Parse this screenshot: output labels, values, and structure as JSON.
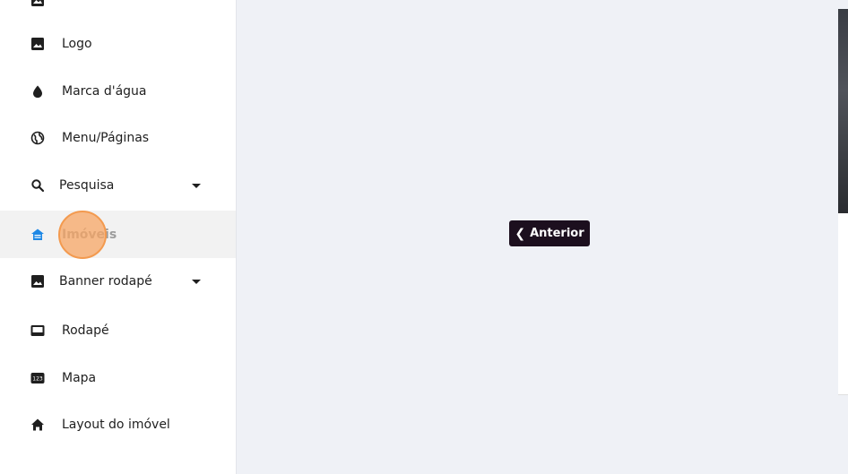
{
  "sidebar": {
    "items": [
      {
        "label": "",
        "icon": "image-icon"
      },
      {
        "label": "Logo",
        "icon": "image-icon"
      },
      {
        "label": "Marca d'água",
        "icon": "water-drop-icon"
      },
      {
        "label": "Menu/Páginas",
        "icon": "globe-icon"
      },
      {
        "label": "Pesquisa",
        "icon": "search-icon",
        "expandable": true
      },
      {
        "label": "Imóveis",
        "icon": "house-icon",
        "active": true
      },
      {
        "label": "Banner rodapé",
        "icon": "image-icon",
        "expandable": true
      },
      {
        "label": "Rodapé",
        "icon": "footer-icon"
      },
      {
        "label": "Mapa",
        "icon": "numbers-icon"
      },
      {
        "label": "Layout do imóvel",
        "icon": "home-icon"
      }
    ]
  },
  "main": {
    "previous_button_label": "Anterior"
  },
  "colors": {
    "active_icon": "#1e88e5",
    "button_bg": "#1c0f1e",
    "click_marker": "#f7a564",
    "page_bg": "#eff1f6"
  }
}
